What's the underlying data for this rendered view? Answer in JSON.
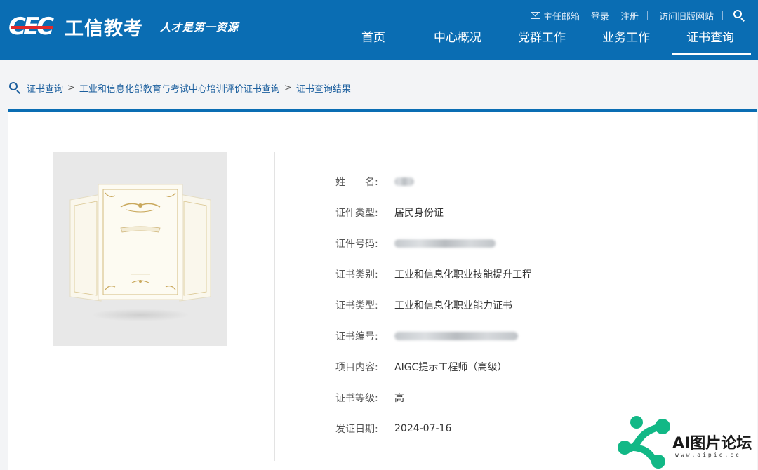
{
  "header": {
    "logo_mark": "CEC",
    "logo_name": "工信教考",
    "slogan": "人才是第一资源",
    "links": {
      "mail": "主任邮箱",
      "login": "登录",
      "register": "注册",
      "old_site": "访问旧版网站"
    },
    "nav": [
      "首页",
      "中心概况",
      "党群工作",
      "业务工作",
      "证书查询"
    ],
    "active_nav": "证书查询"
  },
  "breadcrumb": {
    "items": [
      "证书查询",
      "工业和信息化部教育与考试中心培训评价证书查询",
      "证书查询结果"
    ]
  },
  "certificate": {
    "fields": [
      {
        "label": "姓　　名:",
        "value": "",
        "blurred": true
      },
      {
        "label": "证件类型:",
        "value": "居民身份证",
        "blurred": false
      },
      {
        "label": "证件号码:",
        "value": "",
        "blurred": true
      },
      {
        "label": "证书类别:",
        "value": "工业和信息化职业技能提升工程",
        "blurred": false
      },
      {
        "label": "证书类型:",
        "value": "工业和信息化职业能力证书",
        "blurred": false
      },
      {
        "label": "证书编号:",
        "value": "",
        "blurred": true
      },
      {
        "label": "项目内容:",
        "value": "AIGC提示工程师（高级）",
        "blurred": false
      },
      {
        "label": "证书等级:",
        "value": "高",
        "blurred": false
      },
      {
        "label": "发证日期:",
        "value": "2024-07-16",
        "blurred": false
      }
    ]
  },
  "watermark": {
    "text": "AI图片论坛",
    "url": "www.aipic.cc"
  },
  "colors": {
    "header_blue": "#0a6db3",
    "link_blue": "#1c5f9e",
    "logo_red": "#e02a2a",
    "watermark_green": "#12b886"
  }
}
